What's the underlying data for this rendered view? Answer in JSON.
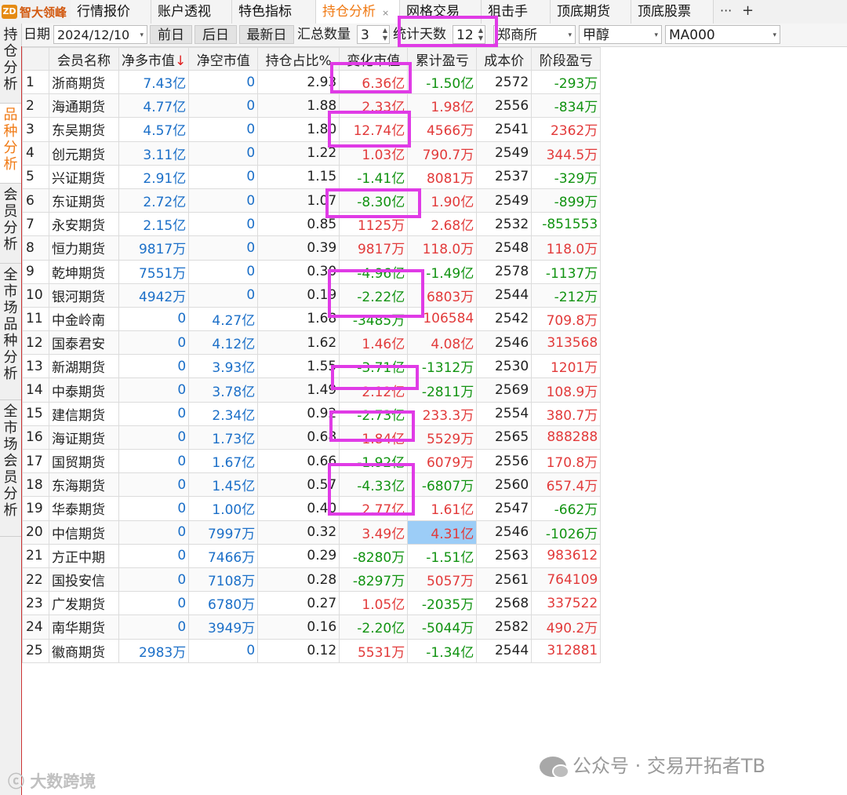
{
  "app": {
    "logo_mark": "ZD",
    "logo_text": "智大领峰"
  },
  "tabs": [
    {
      "label": "行情报价"
    },
    {
      "label": "账户透视"
    },
    {
      "label": "特色指标"
    },
    {
      "label": "持仓分析",
      "active": true,
      "close": "×"
    },
    {
      "label": "网格交易"
    },
    {
      "label": "狙击手"
    },
    {
      "label": "顶底期货"
    },
    {
      "label": "顶底股票"
    }
  ],
  "tab_more": "···",
  "tab_add": "+",
  "toolbar": {
    "date_label": "日期",
    "date_value": "2024/12/10",
    "prev_day": "前日",
    "next_day": "后日",
    "latest_day": "最新日",
    "sum_label": "汇总数量",
    "sum_value": "3",
    "days_label": "统计天数",
    "days_value": "12",
    "exchange": "郑商所",
    "product": "甲醇",
    "contract": "MA000"
  },
  "side_tabs": [
    {
      "label": "持仓分析"
    },
    {
      "label": "品种分析",
      "active": true
    },
    {
      "label": "会员分析"
    },
    {
      "label": "全市场品种分析"
    },
    {
      "label": "全市场会员分析"
    }
  ],
  "table": {
    "headers": [
      "",
      "会员名称",
      "净多市值",
      "净空市值",
      "持仓占比%",
      "变化市值",
      "累计盈亏",
      "成本价",
      "阶段盈亏"
    ],
    "sort_arrow": "↓",
    "rows": [
      [
        "1",
        "浙商期货",
        "7.43亿",
        "0",
        "2.93",
        "6.36亿",
        "-1.50亿",
        "2572",
        "-293万"
      ],
      [
        "2",
        "海通期货",
        "4.77亿",
        "0",
        "1.88",
        "2.33亿",
        "1.98亿",
        "2556",
        "-834万"
      ],
      [
        "3",
        "东吴期货",
        "4.57亿",
        "0",
        "1.80",
        "12.74亿",
        "4566万",
        "2541",
        "2362万"
      ],
      [
        "4",
        "创元期货",
        "3.11亿",
        "0",
        "1.22",
        "1.03亿",
        "790.7万",
        "2549",
        "344.5万"
      ],
      [
        "5",
        "兴证期货",
        "2.91亿",
        "0",
        "1.15",
        "-1.41亿",
        "8081万",
        "2537",
        "-329万"
      ],
      [
        "6",
        "东证期货",
        "2.72亿",
        "0",
        "1.07",
        "-8.30亿",
        "1.90亿",
        "2549",
        "-899万"
      ],
      [
        "7",
        "永安期货",
        "2.15亿",
        "0",
        "0.85",
        "1125万",
        "2.68亿",
        "2532",
        "-851553"
      ],
      [
        "8",
        "恒力期货",
        "9817万",
        "0",
        "0.39",
        "9817万",
        "118.0万",
        "2548",
        "118.0万"
      ],
      [
        "9",
        "乾坤期货",
        "7551万",
        "0",
        "0.30",
        "-4.96亿",
        "-1.49亿",
        "2578",
        "-1137万"
      ],
      [
        "10",
        "银河期货",
        "4942万",
        "0",
        "0.19",
        "-2.22亿",
        "6803万",
        "2544",
        "-212万"
      ],
      [
        "11",
        "中金岭南",
        "0",
        "4.27亿",
        "1.68",
        "-3485万",
        "106584",
        "2542",
        "709.8万"
      ],
      [
        "12",
        "国泰君安",
        "0",
        "4.12亿",
        "1.62",
        "1.46亿",
        "4.08亿",
        "2546",
        "313568"
      ],
      [
        "13",
        "新湖期货",
        "0",
        "3.93亿",
        "1.55",
        "-3.71亿",
        "-1312万",
        "2530",
        "1201万"
      ],
      [
        "14",
        "中泰期货",
        "0",
        "3.78亿",
        "1.49",
        "2.12亿",
        "-2811万",
        "2569",
        "108.9万"
      ],
      [
        "15",
        "建信期货",
        "0",
        "2.34亿",
        "0.92",
        "-2.73亿",
        "233.3万",
        "2554",
        "380.7万"
      ],
      [
        "16",
        "海证期货",
        "0",
        "1.73亿",
        "0.68",
        "1.84亿",
        "5529万",
        "2565",
        "888288"
      ],
      [
        "17",
        "国贸期货",
        "0",
        "1.67亿",
        "0.66",
        "-1.92亿",
        "6079万",
        "2556",
        "170.8万"
      ],
      [
        "18",
        "东海期货",
        "0",
        "1.45亿",
        "0.57",
        "-4.33亿",
        "-6807万",
        "2560",
        "657.4万"
      ],
      [
        "19",
        "华泰期货",
        "0",
        "1.00亿",
        "0.40",
        "2.77亿",
        "1.61亿",
        "2547",
        "-662万"
      ],
      [
        "20",
        "中信期货",
        "0",
        "7997万",
        "0.32",
        "3.49亿",
        "4.31亿",
        "2546",
        "-1026万"
      ],
      [
        "21",
        "方正中期",
        "0",
        "7466万",
        "0.29",
        "-8280万",
        "-1.51亿",
        "2563",
        "983612"
      ],
      [
        "22",
        "国投安信",
        "0",
        "7108万",
        "0.28",
        "-8297万",
        "5057万",
        "2561",
        "764109"
      ],
      [
        "23",
        "广发期货",
        "0",
        "6780万",
        "0.27",
        "1.05亿",
        "-2035万",
        "2568",
        "337522"
      ],
      [
        "24",
        "南华期货",
        "0",
        "3949万",
        "0.16",
        "-2.20亿",
        "-5044万",
        "2582",
        "490.2万"
      ],
      [
        "25",
        "徽商期货",
        "2983万",
        "0",
        "0.12",
        "5531万",
        "-1.34亿",
        "2544",
        "312881"
      ]
    ],
    "selected_cell": {
      "row": 19,
      "col": 6
    }
  },
  "colors": {
    "positive": "#e23a3a",
    "negative": "#119311",
    "market_value": "#1b6fc8",
    "highlight": "#e03be6",
    "active_tab": "#f07a14",
    "selected": "#9ccdf7"
  },
  "watermark": {
    "label": "公众号 · 交易开拓者TB",
    "label2": "大数跨境"
  }
}
